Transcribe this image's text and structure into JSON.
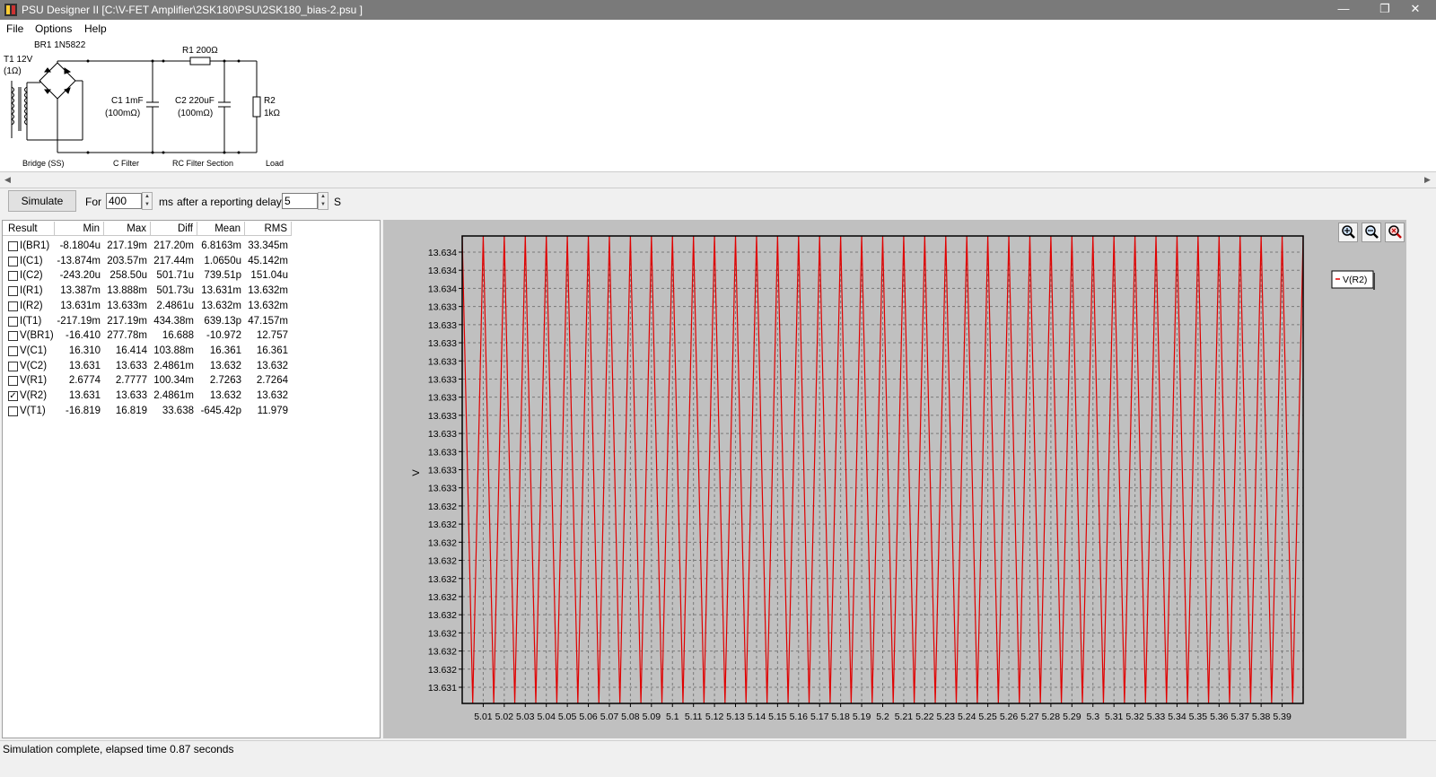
{
  "window": {
    "title": "PSU Designer II  [C:\\V-FET Amplifier\\2SK180\\PSU\\2SK180_bias-2.psu ]",
    "minimize": "—",
    "restore": "❐",
    "close": "✕"
  },
  "menu": {
    "file": "File",
    "options": "Options",
    "help": "Help"
  },
  "schematic": {
    "t1_line1": "T1 12V",
    "t1_line2": "(1Ω)",
    "br1": "BR1 1N5822",
    "r1": "R1 200Ω",
    "c1_line1": "C1 1mF",
    "c1_line2": "(100mΩ)",
    "c2_line1": "C2 220uF",
    "c2_line2": "(100mΩ)",
    "r2_line1": "R2",
    "r2_line2": "1kΩ",
    "section_bridge": "Bridge (SS)",
    "section_cfilter": "C Filter",
    "section_rc": "RC Filter Section",
    "section_load": "Load"
  },
  "toolbar": {
    "simulate": "Simulate",
    "for_label": "For",
    "duration": "400",
    "ms_label": "ms",
    "delay_label": "after a reporting delay of",
    "delay": "5",
    "s_label": "S"
  },
  "results": {
    "headers": [
      "Result",
      "Min",
      "Max",
      "Diff",
      "Mean",
      "RMS"
    ],
    "rows": [
      {
        "name": "I(BR1)",
        "min": "-8.1804u",
        "max": "217.19m",
        "diff": "217.20m",
        "mean": "6.8163m",
        "rms": "33.345m",
        "checked": false
      },
      {
        "name": "I(C1)",
        "min": "-13.874m",
        "max": "203.57m",
        "diff": "217.44m",
        "mean": "1.0650u",
        "rms": "45.142m",
        "checked": false
      },
      {
        "name": "I(C2)",
        "min": "-243.20u",
        "max": "258.50u",
        "diff": "501.71u",
        "mean": "739.51p",
        "rms": "151.04u",
        "checked": false
      },
      {
        "name": "I(R1)",
        "min": "13.387m",
        "max": "13.888m",
        "diff": "501.73u",
        "mean": "13.631m",
        "rms": "13.632m",
        "checked": false
      },
      {
        "name": "I(R2)",
        "min": "13.631m",
        "max": "13.633m",
        "diff": "2.4861u",
        "mean": "13.632m",
        "rms": "13.632m",
        "checked": false
      },
      {
        "name": "I(T1)",
        "min": "-217.19m",
        "max": "217.19m",
        "diff": "434.38m",
        "mean": "639.13p",
        "rms": "47.157m",
        "checked": false
      },
      {
        "name": "V(BR1)",
        "min": "-16.410",
        "max": "277.78m",
        "diff": "16.688",
        "mean": "-10.972",
        "rms": "12.757",
        "checked": false
      },
      {
        "name": "V(C1)",
        "min": "16.310",
        "max": "16.414",
        "diff": "103.88m",
        "mean": "16.361",
        "rms": "16.361",
        "checked": false
      },
      {
        "name": "V(C2)",
        "min": "13.631",
        "max": "13.633",
        "diff": "2.4861m",
        "mean": "13.632",
        "rms": "13.632",
        "checked": false
      },
      {
        "name": "V(R1)",
        "min": "2.6774",
        "max": "2.7777",
        "diff": "100.34m",
        "mean": "2.7263",
        "rms": "2.7264",
        "checked": false
      },
      {
        "name": "V(R2)",
        "min": "13.631",
        "max": "13.633",
        "diff": "2.4861m",
        "mean": "13.632",
        "rms": "13.632",
        "checked": true
      },
      {
        "name": "V(T1)",
        "min": "-16.819",
        "max": "16.819",
        "diff": "33.638",
        "mean": "-645.42p",
        "rms": "11.979",
        "checked": false
      }
    ]
  },
  "colors": {
    "trace": "#e00000",
    "plot_bg": "#c0c0c0",
    "titlebar": "#7a7a7a"
  },
  "icons": {
    "zoom_in": "zoom-in-icon",
    "zoom_out": "zoom-out-icon",
    "zoom_reset": "zoom-reset-icon"
  },
  "chart_data": {
    "type": "line",
    "ylabel": "V",
    "xlim": [
      5.0,
      5.4
    ],
    "ylim": [
      13.631,
      13.634
    ],
    "y_tick_labels": [
      "13.634",
      "13.634",
      "13.634",
      "13.633",
      "13.633",
      "13.633",
      "13.633",
      "13.633",
      "13.633",
      "13.633",
      "13.633",
      "13.633",
      "13.633",
      "13.633",
      "13.632",
      "13.632",
      "13.632",
      "13.632",
      "13.632",
      "13.632",
      "13.632",
      "13.632",
      "13.632",
      "13.632",
      "13.631"
    ],
    "x_tick_labels": [
      "5.01",
      "5.02",
      "5.03",
      "5.04",
      "5.05",
      "5.06",
      "5.07",
      "5.08",
      "5.09",
      "5.1",
      "5.11",
      "5.12",
      "5.13",
      "5.14",
      "5.15",
      "5.16",
      "5.17",
      "5.18",
      "5.19",
      "5.2",
      "5.21",
      "5.22",
      "5.23",
      "5.24",
      "5.25",
      "5.26",
      "5.27",
      "5.28",
      "5.29",
      "5.3",
      "5.31",
      "5.32",
      "5.33",
      "5.34",
      "5.35",
      "5.36",
      "5.37",
      "5.38",
      "5.39"
    ],
    "grid": true,
    "legend": "top-right",
    "series": [
      {
        "name": "V(R2)",
        "color": "#e00000",
        "period": 0.01,
        "min": 13.631,
        "max": 13.634
      }
    ]
  },
  "status": "Simulation complete, elapsed time 0.87 seconds"
}
